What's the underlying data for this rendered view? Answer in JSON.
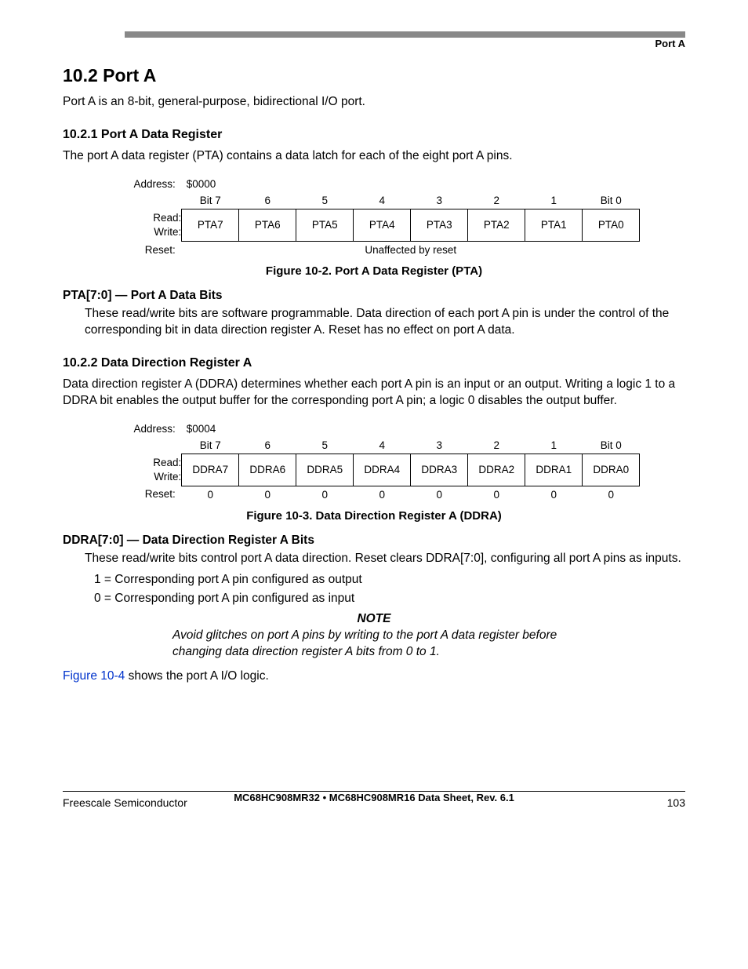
{
  "header": {
    "right_label": "Port A"
  },
  "section": {
    "heading": "10.2  Port A",
    "intro": "Port A is an 8-bit, general-purpose, bidirectional I/O port."
  },
  "sub1021": {
    "heading": "10.2.1  Port A Data Register",
    "intro": "The port A data register (PTA) contains a data latch for each of the eight port A pins.",
    "reg": {
      "address_label": "Address:",
      "address_value": "$0000",
      "bit_labels": [
        "Bit 7",
        "6",
        "5",
        "4",
        "3",
        "2",
        "1",
        "Bit 0"
      ],
      "read_label": "Read:",
      "write_label": "Write:",
      "bit_names": [
        "PTA7",
        "PTA6",
        "PTA5",
        "PTA4",
        "PTA3",
        "PTA2",
        "PTA1",
        "PTA0"
      ],
      "reset_label": "Reset:",
      "reset_value": "Unaffected by reset"
    },
    "caption": "Figure 10-2. Port A Data Register (PTA)",
    "field": {
      "title": "PTA[7:0] — Port A Data Bits",
      "body": "These read/write bits are software programmable. Data direction of each port A pin is under the control of the corresponding bit in data direction register A. Reset has no effect on port A data."
    }
  },
  "sub1022": {
    "heading": "10.2.2  Data Direction Register A",
    "intro": "Data direction register A (DDRA) determines whether each port A pin is an input or an output. Writing a logic 1 to a DDRA bit enables the output buffer for the corresponding port A pin; a logic 0 disables the output buffer.",
    "reg": {
      "address_label": "Address:",
      "address_value": "$0004",
      "bit_labels": [
        "Bit 7",
        "6",
        "5",
        "4",
        "3",
        "2",
        "1",
        "Bit 0"
      ],
      "read_label": "Read:",
      "write_label": "Write:",
      "bit_names": [
        "DDRA7",
        "DDRA6",
        "DDRA5",
        "DDRA4",
        "DDRA3",
        "DDRA2",
        "DDRA1",
        "DDRA0"
      ],
      "reset_label": "Reset:",
      "reset_values": [
        "0",
        "0",
        "0",
        "0",
        "0",
        "0",
        "0",
        "0"
      ]
    },
    "caption": "Figure 10-3. Data Direction Register A (DDRA)",
    "field": {
      "title": "DDRA[7:0] — Data Direction Register A Bits",
      "body": "These read/write bits control port A data direction. Reset clears DDRA[7:0], configuring all port A pins as inputs.",
      "line1": "1 = Corresponding port A pin configured as output",
      "line0": "0 = Corresponding port A pin configured as input"
    },
    "note": {
      "heading": "NOTE",
      "body": "Avoid glitches on port A pins by writing to the port A data register before changing data direction register A bits from 0 to 1."
    },
    "ref_link": "Figure 10-4",
    "ref_suffix": " shows the port A I/O logic."
  },
  "footer": {
    "doc_line": "MC68HC908MR32 • MC68HC908MR16 Data Sheet, Rev. 6.1",
    "left": "Freescale Semiconductor",
    "right": "103"
  }
}
